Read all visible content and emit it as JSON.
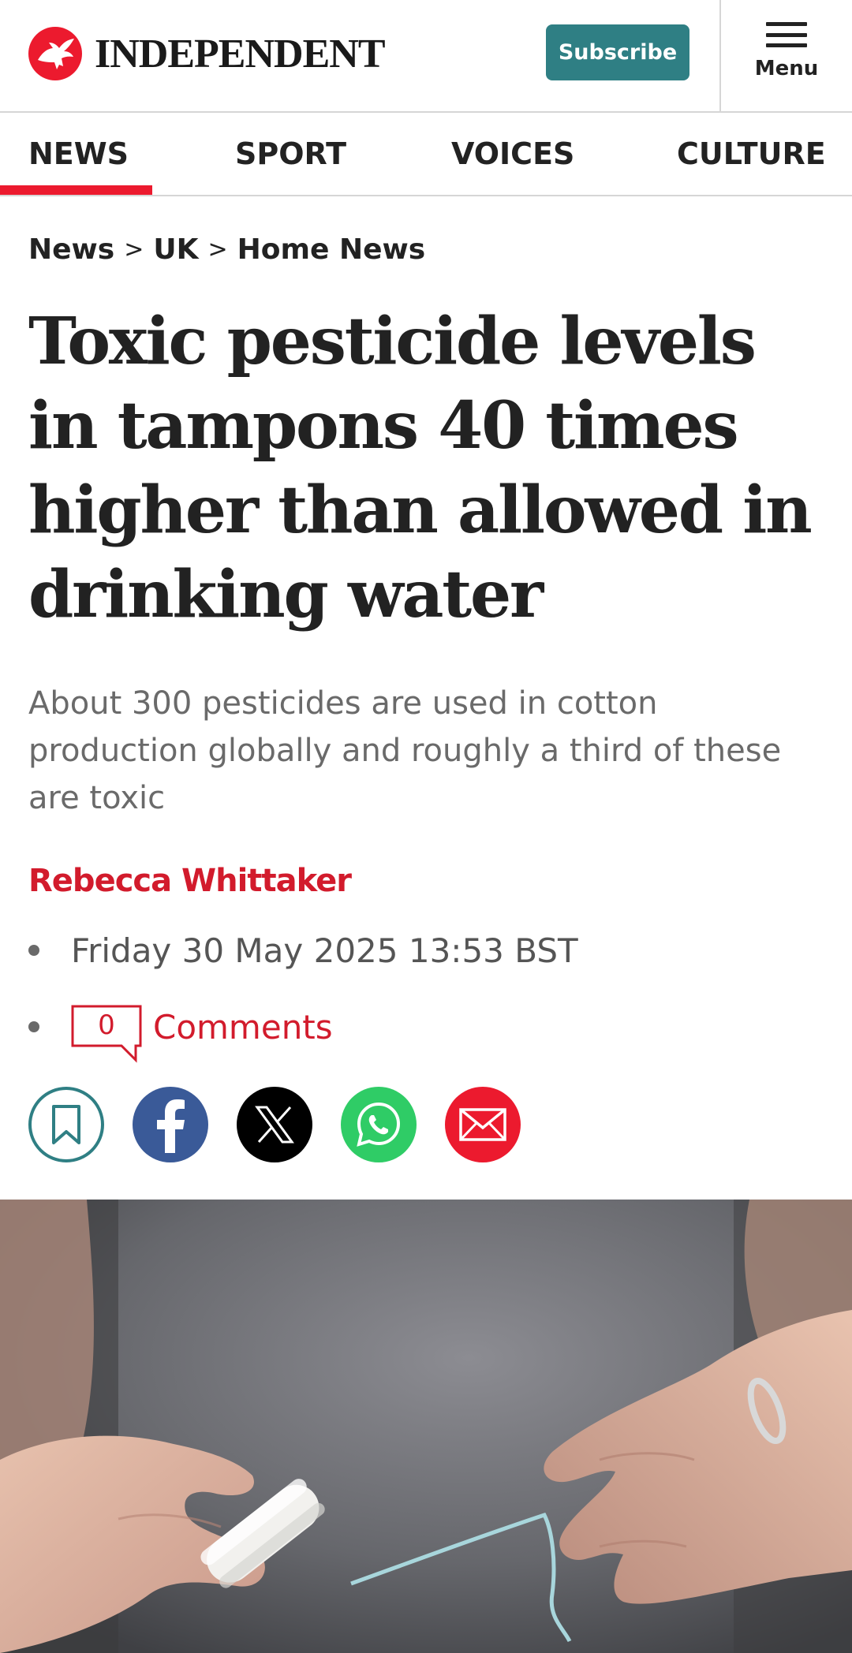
{
  "header": {
    "brand": "INDEPENDENT",
    "subscribe_label": "Subscribe",
    "menu_label": "Menu",
    "colors": {
      "brand_red": "#ec1a2e",
      "subscribe_bg": "#2f7f84"
    }
  },
  "nav": {
    "items": [
      {
        "label": "NEWS",
        "active": true
      },
      {
        "label": "SPORT"
      },
      {
        "label": "VOICES"
      },
      {
        "label": "CULTURE"
      }
    ]
  },
  "breadcrumb": {
    "items": [
      "News",
      "UK",
      "Home News"
    ],
    "separator": ">"
  },
  "article": {
    "headline": "Toxic pesticide levels in tampons 40 times higher than allowed in drinking water",
    "standfirst": "About 300 pesticides are used in cotton production globally and roughly a third of these are toxic",
    "author": "Rebecca Whittaker",
    "date": "Friday 30 May 2025 13:53 BST",
    "comments_count": "0",
    "comments_label": "Comments"
  },
  "share": {
    "icons": [
      "bookmark-icon",
      "facebook-icon",
      "x-icon",
      "whatsapp-icon",
      "email-icon"
    ]
  }
}
